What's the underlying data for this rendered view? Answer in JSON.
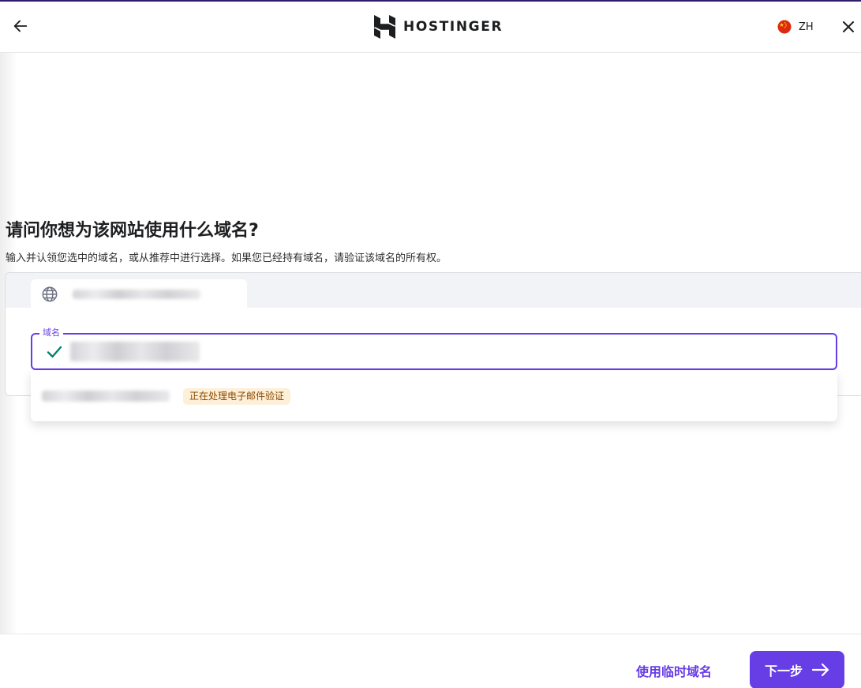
{
  "brand": {
    "name": "HOSTINGER",
    "accent": "#673de6",
    "dark": "#1d1e20"
  },
  "header": {
    "back_icon": "arrow-left-icon",
    "language": {
      "flag_icon": "china-flag-icon",
      "code": "ZH"
    },
    "close_icon": "close-icon"
  },
  "main": {
    "title": "请问你想为该网站使用什么域名?",
    "subtitle": "输入并认领您选中的域名，或从推荐中进行选择。如果您已经持有域名，请验证该域名的所有权。",
    "domain_tab": {
      "icon": "globe-icon",
      "label": "xxxxxxxxxxxxxxxxxxxx"
    },
    "field": {
      "label": "域名",
      "value": "xxxxxxxxxxxxxxxxxxxx",
      "status_icon": "check-icon"
    },
    "suggestions": [
      {
        "domain": "xxxxxxxxxxxxxxxxxxxx",
        "badge": "正在处理电子邮件验证",
        "badge_bg": "#feefd9",
        "badge_color": "#8a4b00"
      }
    ]
  },
  "footer": {
    "temp_domain_label": "使用临时域名",
    "next_label": "下一步",
    "next_icon": "arrow-right-icon"
  }
}
